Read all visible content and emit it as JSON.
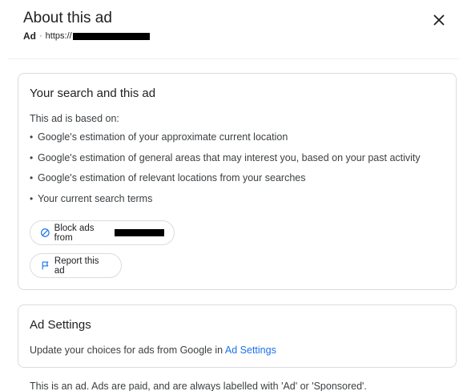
{
  "dialog": {
    "title": "About this ad",
    "ad_label": "Ad",
    "separator": "·",
    "url_prefix": "https://",
    "close_icon": "close-icon"
  },
  "search_card": {
    "title": "Your search and this ad",
    "based_on": "This ad is based on:",
    "reasons": [
      "Google's estimation of your approximate current location",
      "Google's estimation of general areas that may interest you, based on your past activity",
      "Google's estimation of relevant locations from your searches",
      "Your current search terms"
    ],
    "block_button": {
      "label": "Block ads from",
      "icon": "block-icon"
    },
    "report_button": {
      "label": "Report this ad",
      "icon": "flag-icon"
    }
  },
  "settings_card": {
    "title": "Ad Settings",
    "text": "Update your choices for ads from Google in ",
    "link": "Ad Settings"
  },
  "footer": {
    "text": "This is an ad. Ads are paid, and are always labelled with 'Ad' or 'Sponsored'."
  },
  "colors": {
    "link": "#1a73e8",
    "text": "#202124",
    "secondary_text": "#3c4043",
    "border": "#dadce0",
    "redaction": "#000000"
  }
}
